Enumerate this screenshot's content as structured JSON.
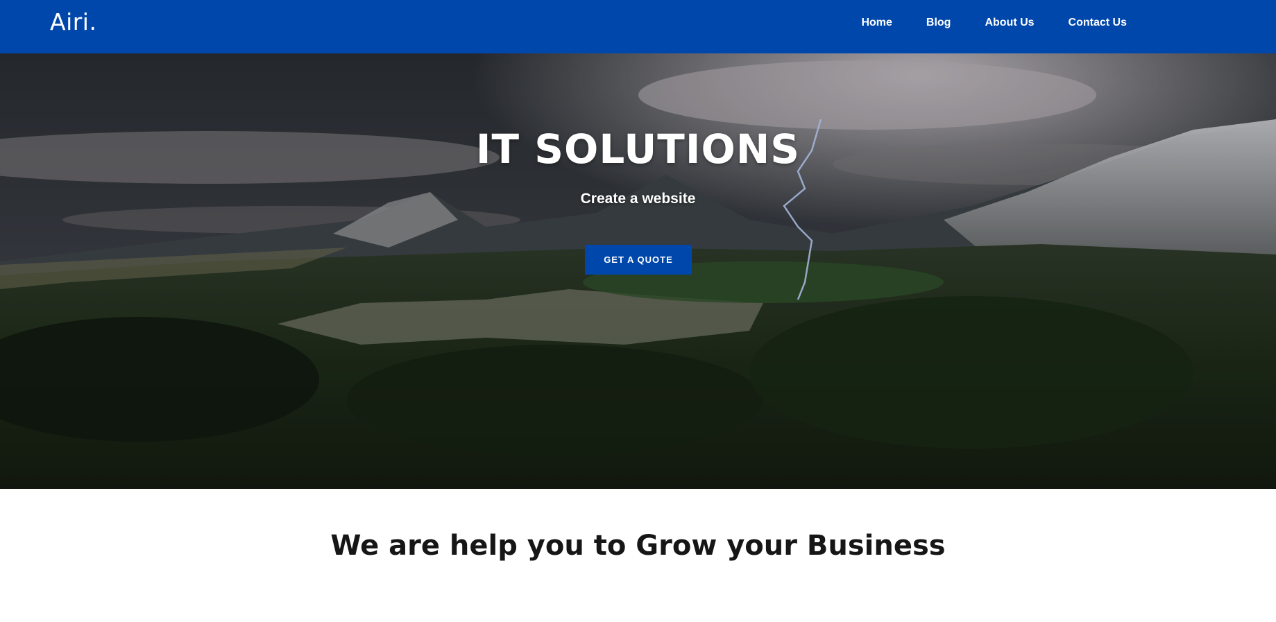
{
  "brand": {
    "logo_text": "Airi."
  },
  "nav": {
    "items": [
      {
        "label": "Home"
      },
      {
        "label": "Blog"
      },
      {
        "label": "About Us"
      },
      {
        "label": "Contact Us"
      }
    ]
  },
  "hero": {
    "title": "IT SOLUTIONS",
    "subtitle": "Create a website",
    "cta_label": "GET A QUOTE",
    "background_image": "stormy mountain valley with lightning over a pine forest"
  },
  "section": {
    "heading": "We are help you to Grow your Business"
  },
  "colors": {
    "brand_blue": "#0047ab",
    "text_dark": "#161616",
    "white": "#ffffff"
  }
}
